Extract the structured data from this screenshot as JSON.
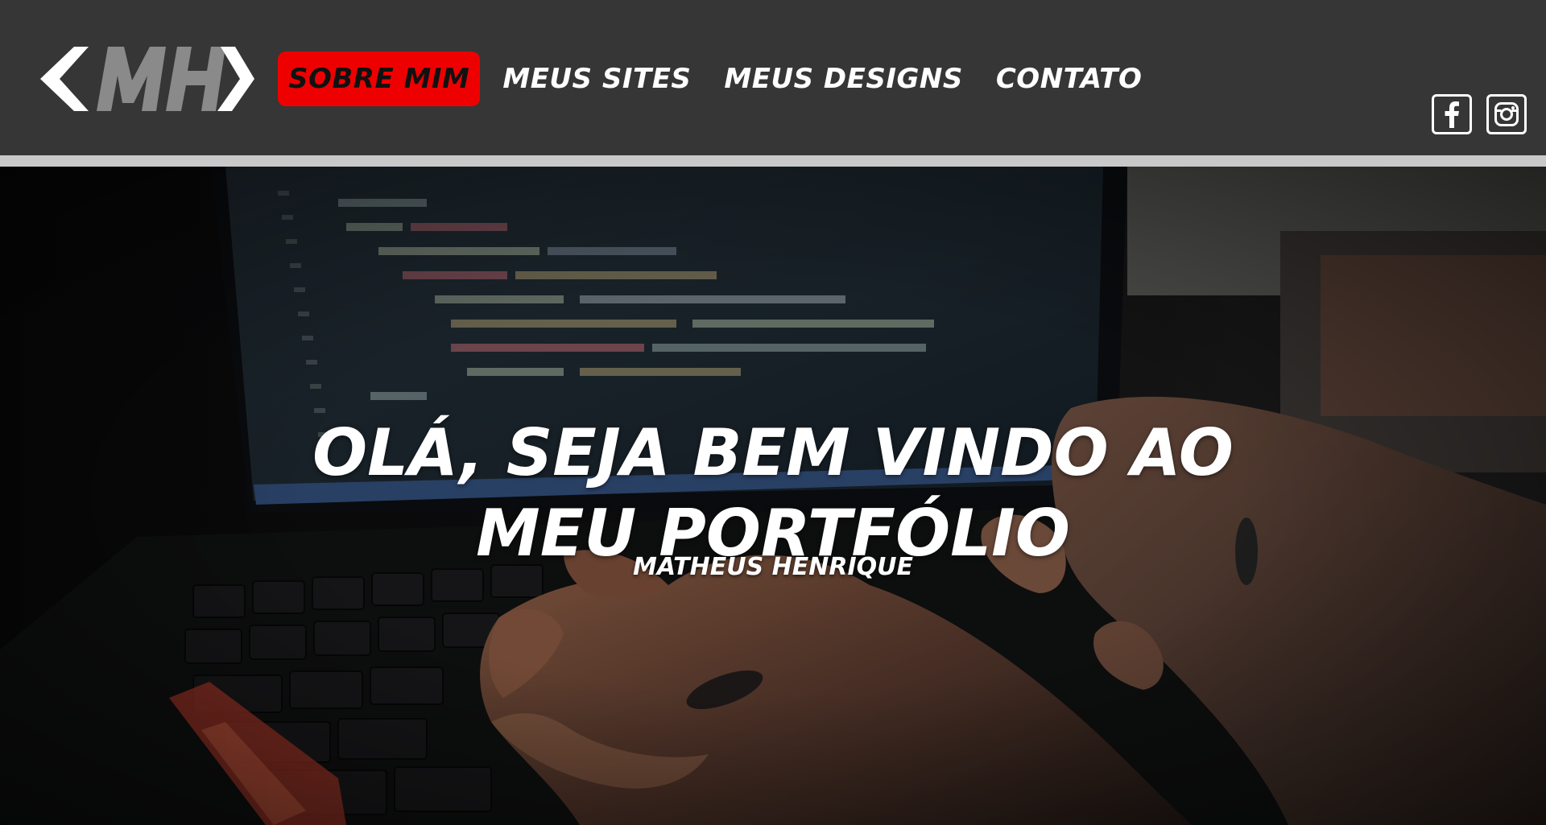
{
  "logo": {
    "text": "<MH>",
    "icon": "mh-logo"
  },
  "nav": {
    "items": [
      {
        "label": "SOBRE MIM",
        "active": true
      },
      {
        "label": "MEUS SITES",
        "active": false
      },
      {
        "label": "MEUS DESIGNS",
        "active": false
      },
      {
        "label": "CONTATO",
        "active": false
      }
    ]
  },
  "social": {
    "facebook_icon": "facebook-icon",
    "instagram_icon": "instagram-icon"
  },
  "hero": {
    "title_line1": "OLÁ, SEJA BEM VINDO AO",
    "title_line2": "MEU PORTFÓLIO",
    "subtitle": "MATHEUS HENRIQUE"
  },
  "colors": {
    "header_bg": "#363636",
    "divider": "#c9c9c9",
    "accent": "#ef0000",
    "logo_gray": "#8a8a8a"
  }
}
